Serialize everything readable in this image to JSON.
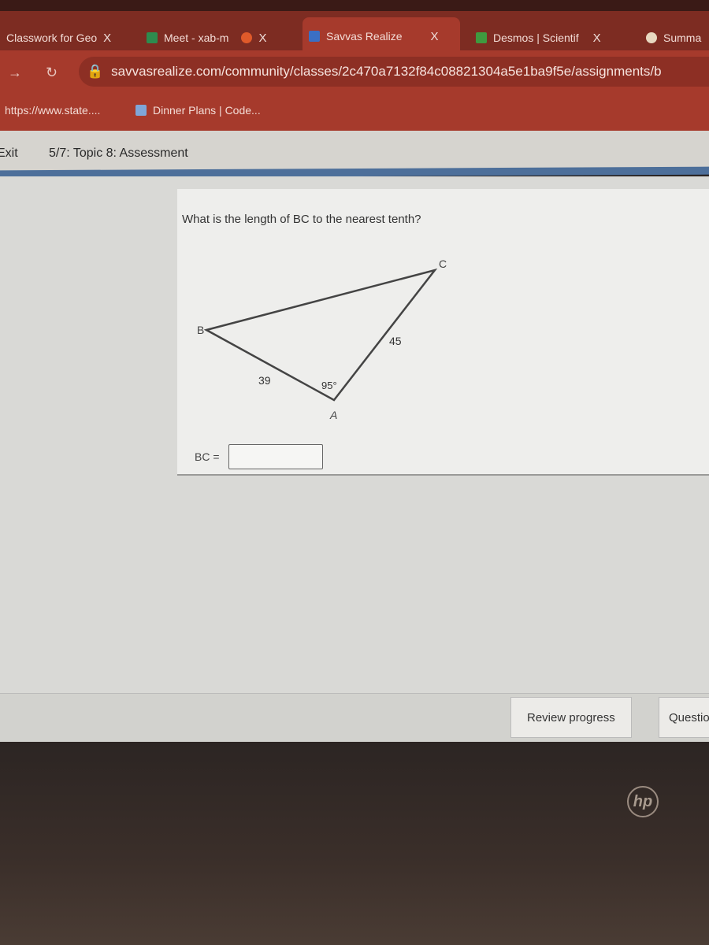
{
  "browser": {
    "tabs": [
      {
        "label": "Classwork for Geo",
        "active": false
      },
      {
        "label": "Meet - xab-m",
        "active": false
      },
      {
        "label": "Savvas Realize",
        "active": true
      },
      {
        "label": "Desmos | Scientif",
        "active": false
      },
      {
        "label": "Summa",
        "active": false
      }
    ],
    "close_glyph": "X",
    "url": "savvasrealize.com/community/classes/2c470a7132f84c08821304a5e1ba9f5e/assignments/b",
    "bookmarks": [
      {
        "label": "https://www.state...."
      },
      {
        "label": "Dinner Plans | Code..."
      }
    ],
    "colors": {
      "frame": "#7d2c22",
      "active": "#a63a2c"
    }
  },
  "app": {
    "exit_label": "Exit",
    "title": "5/7: Topic 8: Assessment",
    "accent": "#4d6f9a"
  },
  "question": {
    "prompt": "What is the length of BC to the nearest tenth?",
    "vertices": {
      "A": "A",
      "B": "B",
      "C": "C"
    },
    "side_ab": "39",
    "side_ac": "45",
    "angle_a": "95°",
    "answer_label": "BC =",
    "answer_value": ""
  },
  "footer": {
    "review_label": "Review progress",
    "question_label": "Questio"
  },
  "laptop": {
    "logo": "hp"
  }
}
